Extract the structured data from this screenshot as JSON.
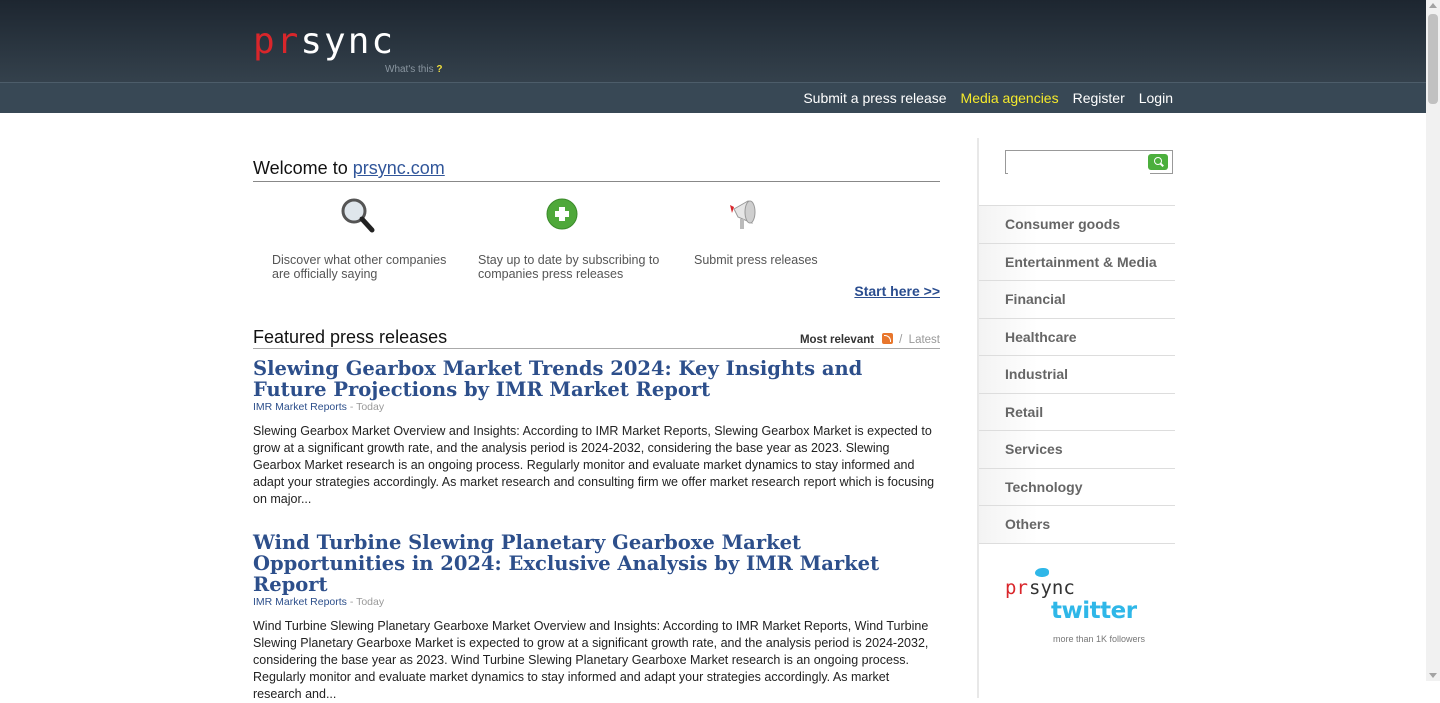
{
  "header": {
    "logo_pr": "pr",
    "logo_sync": "sync",
    "whats_this": "What's this",
    "whats_this_q": "?"
  },
  "nav": {
    "items": [
      {
        "label": "Submit a press release"
      },
      {
        "label": "Media agencies"
      },
      {
        "label": "Register"
      },
      {
        "label": "Login"
      }
    ]
  },
  "welcome": {
    "prefix": "Welcome to",
    "link": "prsync.com"
  },
  "features": [
    {
      "icon": "magnifier-icon",
      "text": "Discover what other companies are officially saying"
    },
    {
      "icon": "plus-icon",
      "text": "Stay up to date by subscribing to companies press releases"
    },
    {
      "icon": "megaphone-icon",
      "text": "Submit press releases"
    }
  ],
  "start_link": "Start here >>",
  "featured": {
    "title": "Featured press releases",
    "sort_relevant": "Most relevant",
    "sort_sep": "/",
    "sort_latest": "Latest"
  },
  "press_releases": [
    {
      "title": "Slewing Gearbox Market Trends 2024: Key Insights and Future Projections by IMR Market Report",
      "source": "IMR Market Reports",
      "when": "- Today",
      "description": "Slewing Gearbox Market Overview and Insights: According to IMR Market Reports, Slewing Gearbox Market is expected to grow at a significant growth rate, and the analysis period is 2024-2032, considering the base year as 2023. Slewing Gearbox Market research is an ongoing process. Regularly monitor and evaluate market dynamics to stay informed and adapt your strategies accordingly. As market research and consulting firm we offer market research report which is focusing on major..."
    },
    {
      "title": "Wind Turbine Slewing Planetary Gearboxe Market Opportunities in 2024: Exclusive Analysis by IMR Market Report",
      "source": "IMR Market Reports",
      "when": "- Today",
      "description": "Wind Turbine Slewing Planetary Gearboxe Market Overview and Insights: According to IMR Market Reports, Wind Turbine Slewing Planetary Gearboxe Market is expected to grow at a significant growth rate, and the analysis period is 2024-2032, considering the base year as 2023. Wind Turbine Slewing Planetary Gearboxe Market research is an ongoing process. Regularly monitor and evaluate market dynamics to stay informed and adapt your strategies accordingly. As market research and..."
    }
  ],
  "sidebar": {
    "search_placeholder": "",
    "categories": [
      {
        "label": "Consumer goods"
      },
      {
        "label": "Entertainment & Media"
      },
      {
        "label": "Financial"
      },
      {
        "label": "Healthcare"
      },
      {
        "label": "Industrial"
      },
      {
        "label": "Retail"
      },
      {
        "label": "Services"
      },
      {
        "label": "Technology"
      },
      {
        "label": "Others"
      }
    ],
    "twitter": {
      "pr": "pr",
      "sync": "sync",
      "word": "twitter",
      "followers": "more than 1K followers"
    }
  },
  "colors": {
    "accent_link": "#2d4f8b",
    "nav_active": "#f5ea2c",
    "logo_red": "#d9262b",
    "twitter_blue": "#2fb7e8"
  }
}
